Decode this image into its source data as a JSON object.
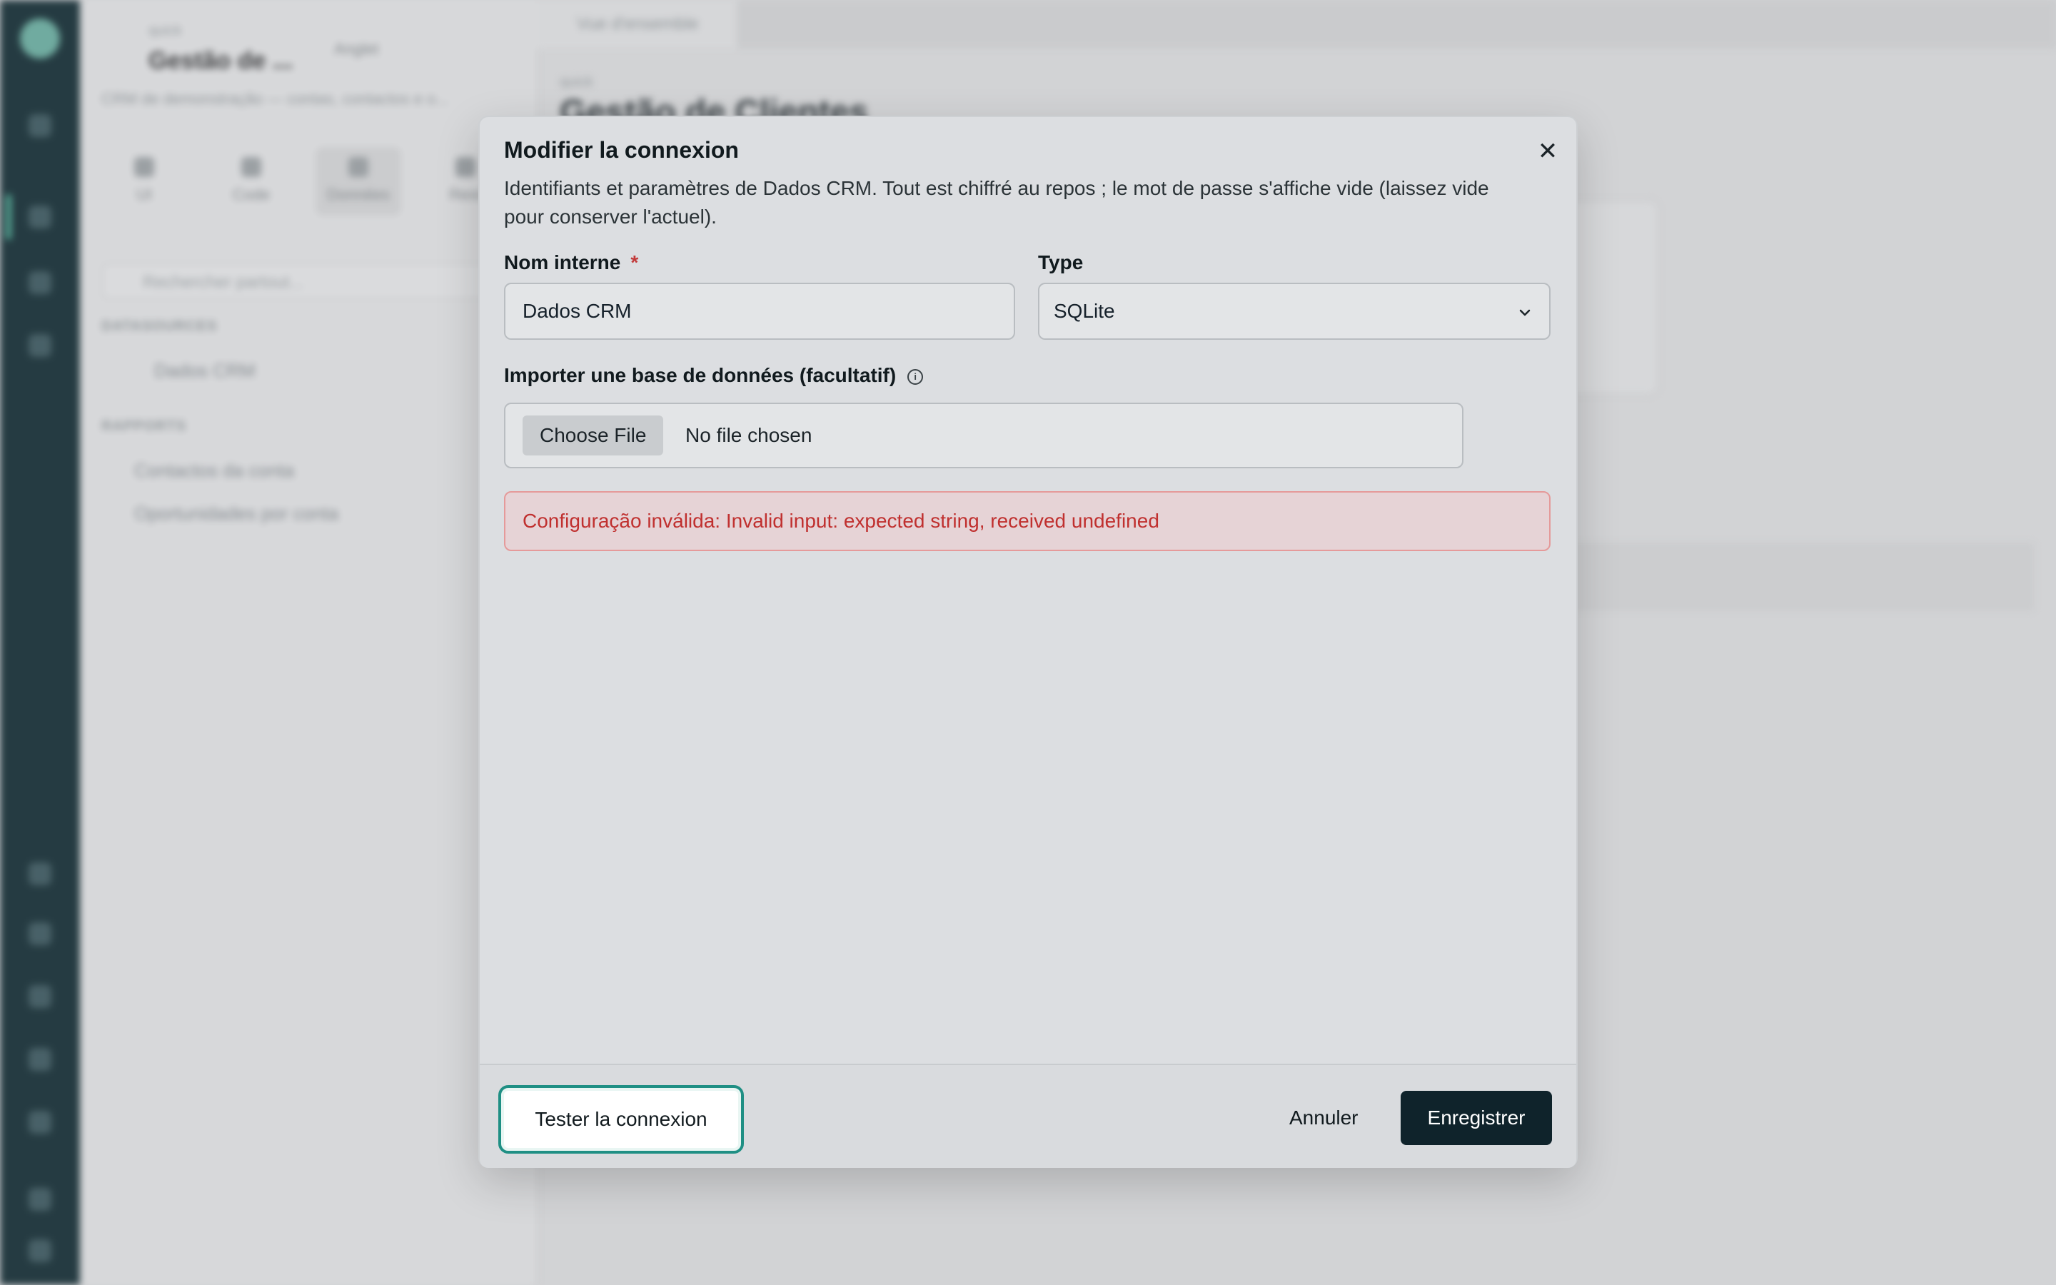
{
  "background": {
    "sidebar": {
      "caption": "quick",
      "title": "Gestão de ...",
      "user": "Anglet",
      "subtitle": "CRM de demonstração — contas, contactos e o...",
      "tabs": [
        "UI",
        "Code",
        "Données",
        "Rest"
      ],
      "search_placeholder": "Rechercher partout...",
      "section_datasources": "DATASOURCES",
      "datasource_item": "Dados CRM",
      "section_reports": "RAPPORTS",
      "reports": [
        "Contactos da conta",
        "Oportunidades por conta"
      ]
    },
    "main": {
      "tab_label": "Vue d'ensemble",
      "caption": "quick",
      "title": "Gestão de Clientes"
    }
  },
  "modal": {
    "title": "Modifier la connexion",
    "close_icon": "close-icon",
    "description": "Identifiants et paramètres de Dados CRM. Tout est chiffré au repos ; le mot de passe s'affiche vide (laissez vide pour conserver l'actuel).",
    "name_field": {
      "label": "Nom interne",
      "required_mark": "*",
      "value": "Dados CRM"
    },
    "type_field": {
      "label": "Type",
      "value": "SQLite"
    },
    "import_field": {
      "label": "Importer une base de données (facultatif)",
      "button_label": "Choose File",
      "status": "No file chosen"
    },
    "error_message": "Configuração inválida: Invalid input: expected string, received undefined",
    "footer": {
      "test_label": "Tester la connexion",
      "cancel_label": "Annuler",
      "save_label": "Enregistrer"
    }
  },
  "colors": {
    "primary": "#0f232b",
    "focus_ring": "#1f8f84",
    "error": "#c0302f",
    "rail": "#0f2a30"
  }
}
